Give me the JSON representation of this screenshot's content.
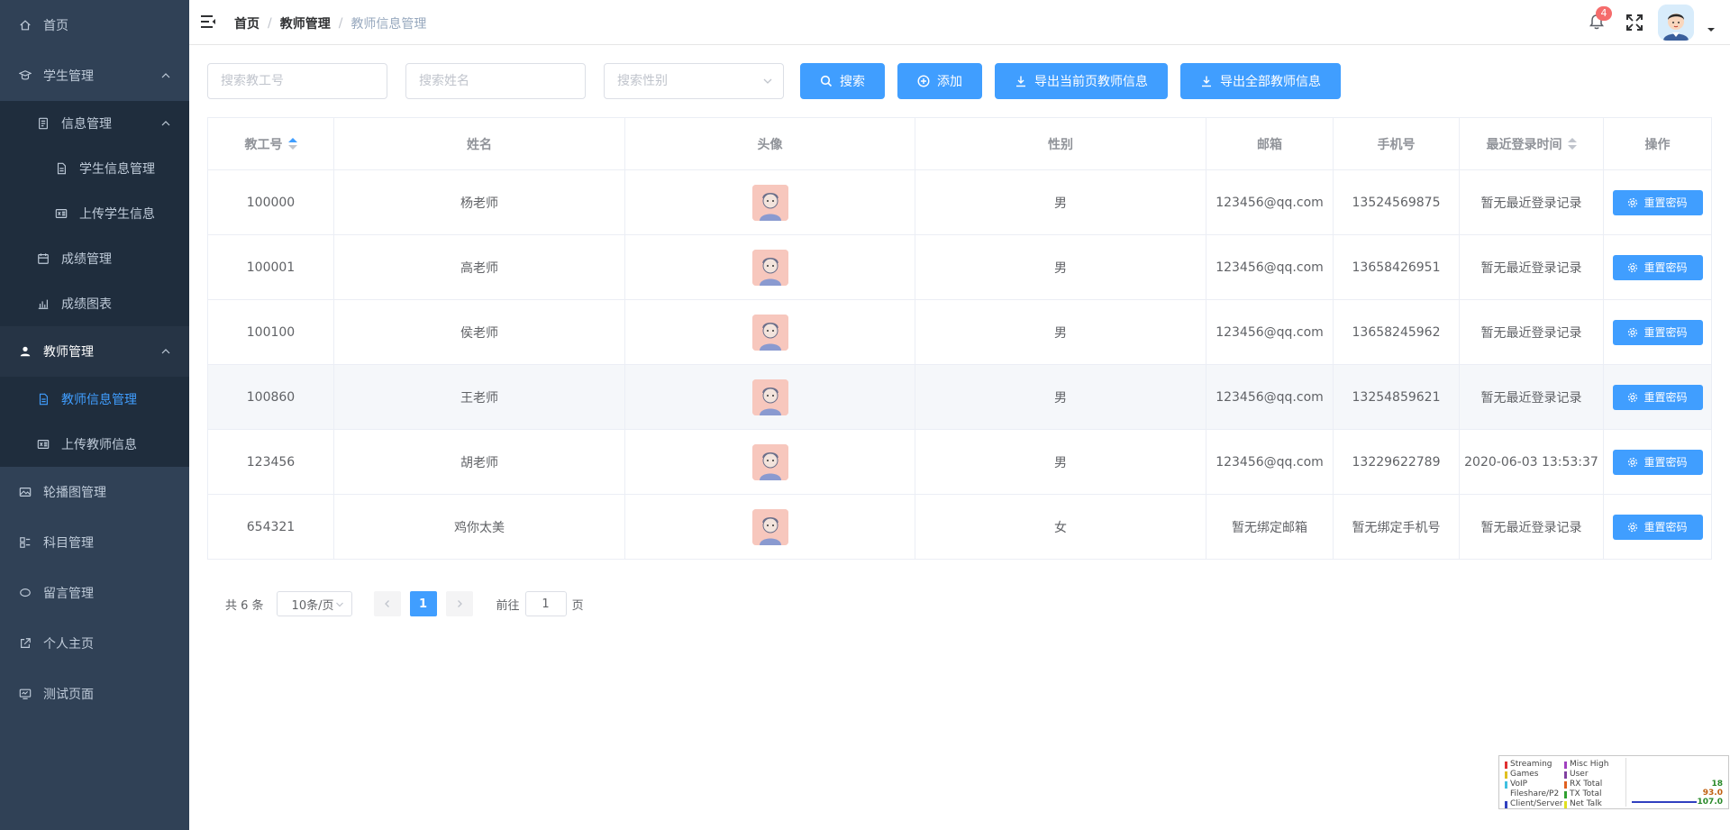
{
  "sidebar": {
    "items": [
      {
        "label": "首页"
      },
      {
        "label": "学生管理"
      },
      {
        "label": "信息管理"
      },
      {
        "label": "学生信息管理"
      },
      {
        "label": "上传学生信息"
      },
      {
        "label": "成绩管理"
      },
      {
        "label": "成绩图表"
      },
      {
        "label": "教师管理"
      },
      {
        "label": "教师信息管理"
      },
      {
        "label": "上传教师信息"
      },
      {
        "label": "轮播图管理"
      },
      {
        "label": "科目管理"
      },
      {
        "label": "留言管理"
      },
      {
        "label": "个人主页"
      },
      {
        "label": "测试页面"
      }
    ]
  },
  "header": {
    "breadcrumb": [
      "首页",
      "教师管理",
      "教师信息管理"
    ],
    "separator": "/",
    "notification_count": "4"
  },
  "filters": {
    "id_placeholder": "搜索教工号",
    "name_placeholder": "搜索姓名",
    "gender_placeholder": "搜索性别",
    "search_label": "搜索",
    "add_label": "添加",
    "export_page_label": "导出当前页教师信息",
    "export_all_label": "导出全部教师信息"
  },
  "table": {
    "columns": [
      "教工号",
      "姓名",
      "头像",
      "性别",
      "邮箱",
      "手机号",
      "最近登录时间",
      "操作"
    ],
    "reset_label": "重置密码",
    "rows": [
      {
        "id": "100000",
        "name": "杨老师",
        "gender": "男",
        "email": "123456@qq.com",
        "phone": "13524569875",
        "last_login": "暂无最近登录记录"
      },
      {
        "id": "100001",
        "name": "高老师",
        "gender": "男",
        "email": "123456@qq.com",
        "phone": "13658426951",
        "last_login": "暂无最近登录记录"
      },
      {
        "id": "100100",
        "name": "侯老师",
        "gender": "男",
        "email": "123456@qq.com",
        "phone": "13658245962",
        "last_login": "暂无最近登录记录"
      },
      {
        "id": "100860",
        "name": "王老师",
        "gender": "男",
        "email": "123456@qq.com",
        "phone": "13254859621",
        "last_login": "暂无最近登录记录"
      },
      {
        "id": "123456",
        "name": "胡老师",
        "gender": "男",
        "email": "123456@qq.com",
        "phone": "13229622789",
        "last_login": "2020-06-03 13:53:37"
      },
      {
        "id": "654321",
        "name": "鸡你太美",
        "gender": "女",
        "email": "暂无绑定邮箱",
        "phone": "暂无绑定手机号",
        "last_login": "暂无最近登录记录"
      }
    ]
  },
  "pagination": {
    "total": "共 6 条",
    "page_size": "10条/页",
    "current_page": "1",
    "goto_prefix": "前往",
    "goto_value": "1",
    "goto_suffix": "页"
  },
  "netmeter": {
    "left_labels": [
      "Streaming",
      "Games",
      "VoIP",
      "Fileshare/P2",
      "Client/Server"
    ],
    "right_labels": [
      "Misc High",
      "User",
      "RX Total",
      "TX Total",
      "Net Talk"
    ],
    "values": [
      "18",
      "93.0",
      "107.0"
    ]
  },
  "colors": {
    "sidebar_bg": "#304156",
    "accent": "#409eff",
    "badge": "#f56c6c"
  }
}
